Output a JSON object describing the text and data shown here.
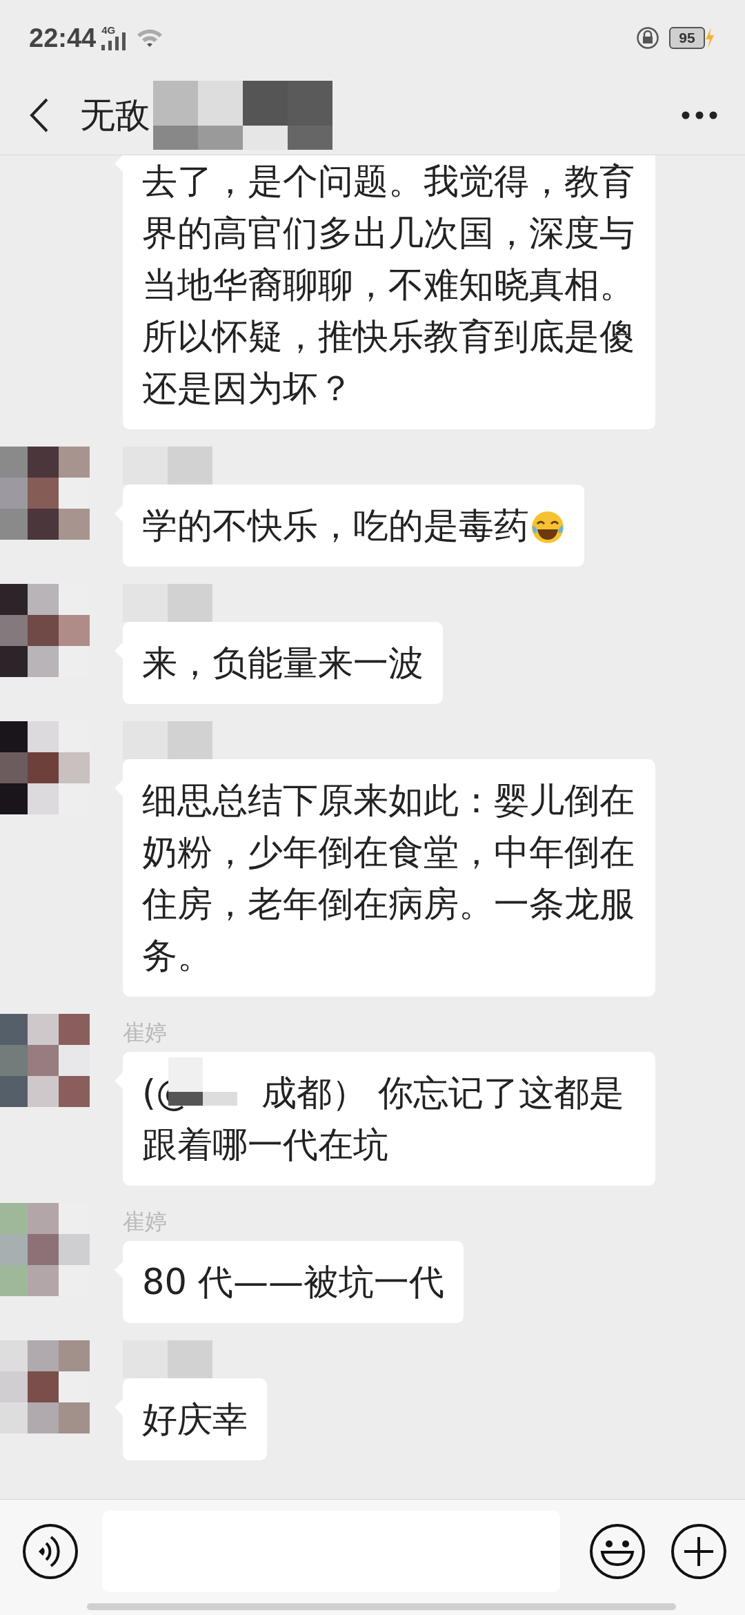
{
  "status_bar": {
    "time": "22:44",
    "network": "4G",
    "battery": "95",
    "charging": true
  },
  "header": {
    "title": "无敌"
  },
  "messages": [
    {
      "text": "去了，是个问题。我觉得，教育界的高官们多出几次国，深度与当地华裔聊聊，不难知晓真相。所以怀疑，推快乐教育到底是傻还是因为坏？"
    },
    {
      "text": "学的不快乐，吃的是毒药",
      "kind": "with_emoji"
    },
    {
      "text": "来，负能量来一波"
    },
    {
      "text": "细思总结下原来如此：婴儿倒在奶粉，少年倒在食堂，中年倒在住房，老年倒在病房。一条龙服务。"
    },
    {
      "sender": "崔婷",
      "text": "(@　　成都） 你忘记了这都是跟着哪一代在坑",
      "redacted_mention": true
    },
    {
      "sender": "崔婷",
      "text": "80 代——被坑一代"
    },
    {
      "text": "好庆幸"
    }
  ]
}
